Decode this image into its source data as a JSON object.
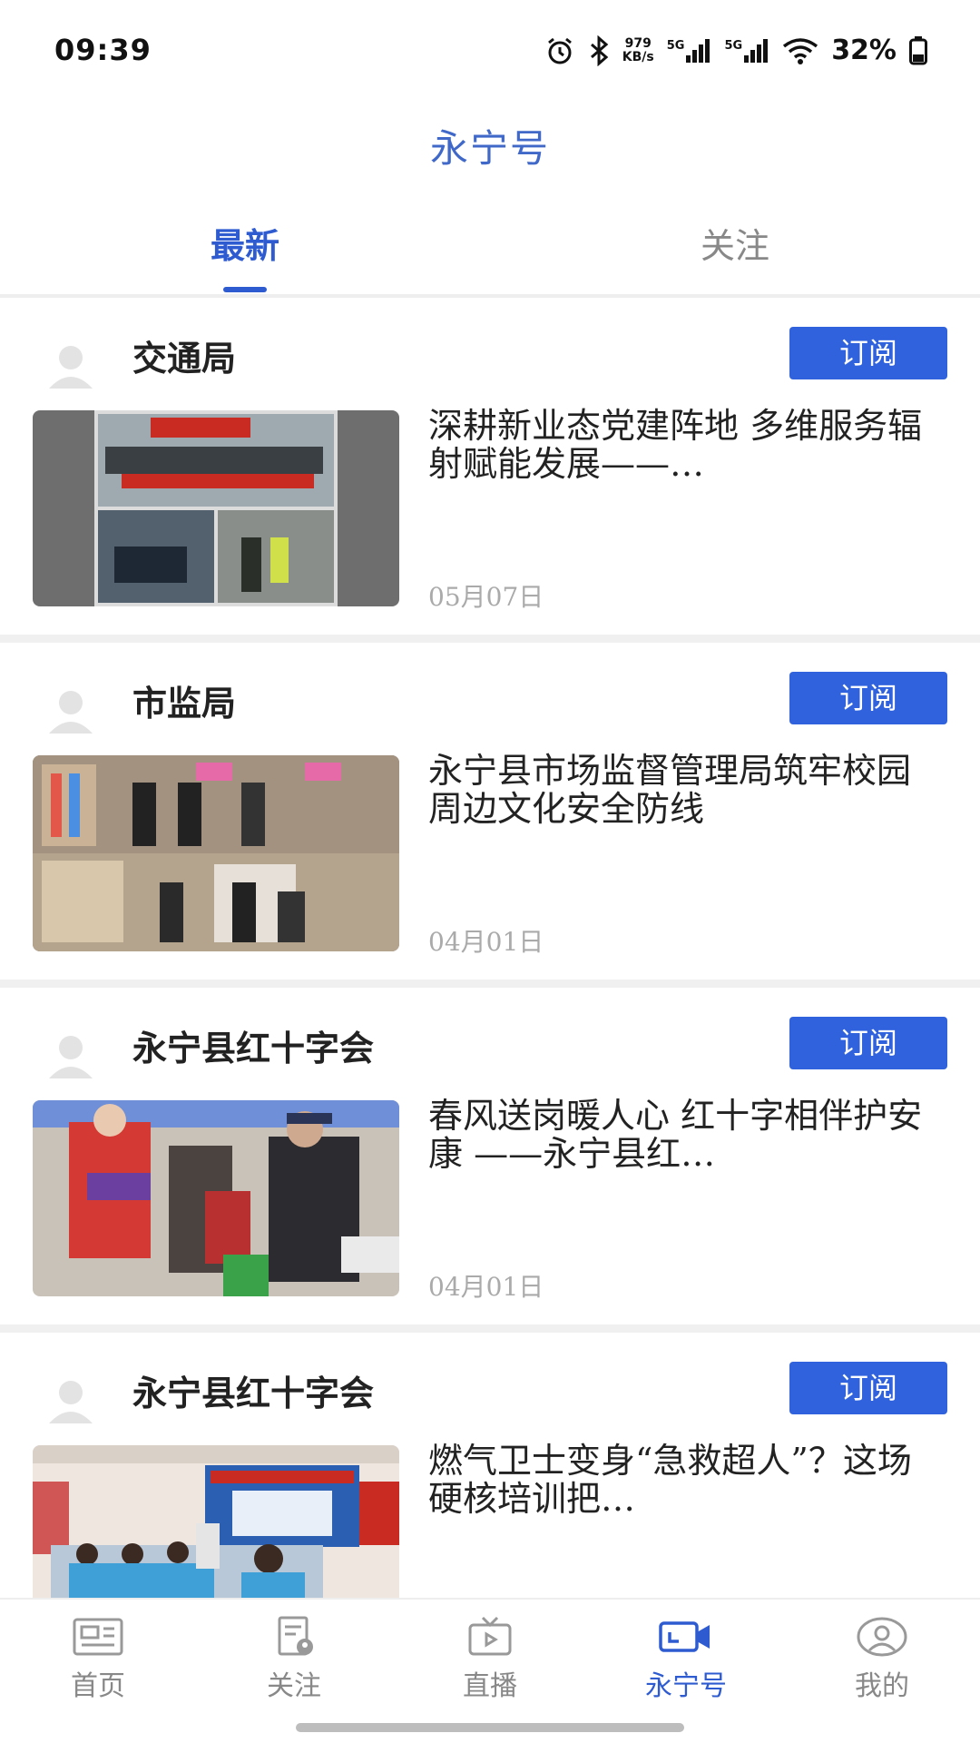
{
  "status_bar": {
    "time": "09:39",
    "net_speed_value": "979",
    "net_speed_unit": "KB/s",
    "signal_1": "5G",
    "signal_2": "5G",
    "battery": "32%"
  },
  "header": {
    "title": "永宁号"
  },
  "tabs": [
    {
      "label": "最新",
      "active": true
    },
    {
      "label": "关注",
      "active": false
    }
  ],
  "feed": [
    {
      "source": "交通局",
      "subscribe_label": "订阅",
      "title": "深耕新业态党建阵地 多维服务辐射赋能发展——…",
      "date": "05月07日"
    },
    {
      "source": "市监局",
      "subscribe_label": "订阅",
      "title": "永宁县市场监督管理局筑牢校园周边文化安全防线",
      "date": "04月01日"
    },
    {
      "source": "永宁县红十字会",
      "subscribe_label": "订阅",
      "title": "春风送岗暖人心 红十字相伴护安康 ——永宁县红…",
      "date": "04月01日"
    },
    {
      "source": "永宁县红十字会",
      "subscribe_label": "订阅",
      "title": "燃气卫士变身“急救超人”？这场硬核培训把…",
      "date": ""
    }
  ],
  "bottom_nav": [
    {
      "label": "首页",
      "icon": "newspaper-icon",
      "active": false
    },
    {
      "label": "关注",
      "icon": "follow-doc-icon",
      "active": false
    },
    {
      "label": "直播",
      "icon": "tv-icon",
      "active": false
    },
    {
      "label": "永宁号",
      "icon": "video-camera-icon",
      "active": true
    },
    {
      "label": "我的",
      "icon": "user-circle-icon",
      "active": false
    }
  ],
  "colors": {
    "accent": "#2e5bd0",
    "subscribe_bg": "#2f62dc",
    "inactive": "#888888"
  }
}
